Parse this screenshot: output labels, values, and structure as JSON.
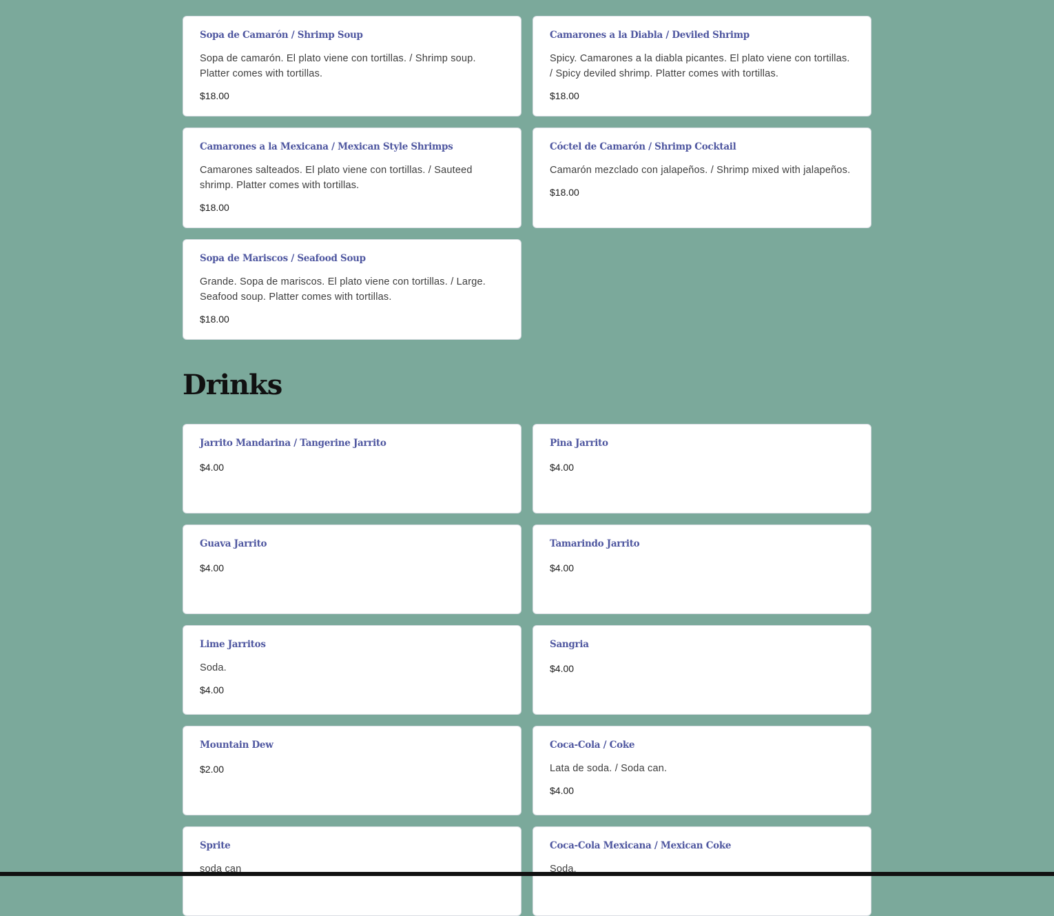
{
  "seafood": {
    "items": [
      {
        "title": "Sopa de Camarón / Shrimp Soup",
        "desc": "Sopa de camarón. El plato viene con tortillas. / Shrimp soup. Platter comes with tortillas.",
        "price": "$18.00"
      },
      {
        "title": "Camarones a la Diabla / Deviled Shrimp",
        "desc": "Spicy. Camarones a la diabla picantes. El plato viene con tortillas. / Spicy deviled shrimp. Platter comes with tortillas.",
        "price": "$18.00"
      },
      {
        "title": "Camarones a la Mexicana / Mexican Style Shrimps",
        "desc": "Camarones salteados. El plato viene con tortillas. / Sauteed shrimp. Platter comes with tortillas.",
        "price": "$18.00"
      },
      {
        "title": "Cóctel de Camarón / Shrimp Cocktail",
        "desc": "Camarón mezclado con jalapeños. / Shrimp mixed with jalapeños.",
        "price": "$18.00"
      },
      {
        "title": "Sopa de Mariscos / Seafood Soup",
        "desc": "Grande. Sopa de mariscos. El plato viene con tortillas. / Large. Seafood soup. Platter comes with tortillas.",
        "price": "$18.00"
      }
    ]
  },
  "drinks": {
    "heading": "Drinks",
    "items": [
      {
        "title": "Jarrito Mandarina / Tangerine Jarrito",
        "price": "$4.00"
      },
      {
        "title": "Pina Jarrito",
        "price": "$4.00"
      },
      {
        "title": "Guava Jarrito",
        "price": "$4.00"
      },
      {
        "title": "Tamarindo Jarrito",
        "price": "$4.00"
      },
      {
        "title": "Lime Jarritos",
        "desc": "Soda.",
        "price": "$4.00"
      },
      {
        "title": "Sangria",
        "price": "$4.00"
      },
      {
        "title": "Mountain Dew",
        "price": "$2.00"
      },
      {
        "title": "Coca-Cola / Coke",
        "desc": "Lata de soda. / Soda can.",
        "price": "$4.00"
      },
      {
        "title": "Sprite",
        "desc": "soda can",
        "price": ""
      },
      {
        "title": "Coca-Cola Mexicana / Mexican Coke",
        "desc": "Soda.",
        "price": ""
      }
    ]
  },
  "colors": {
    "background": "#7ba99b",
    "card": "#ffffff",
    "title": "#4f57a0",
    "heading": "#111111"
  }
}
